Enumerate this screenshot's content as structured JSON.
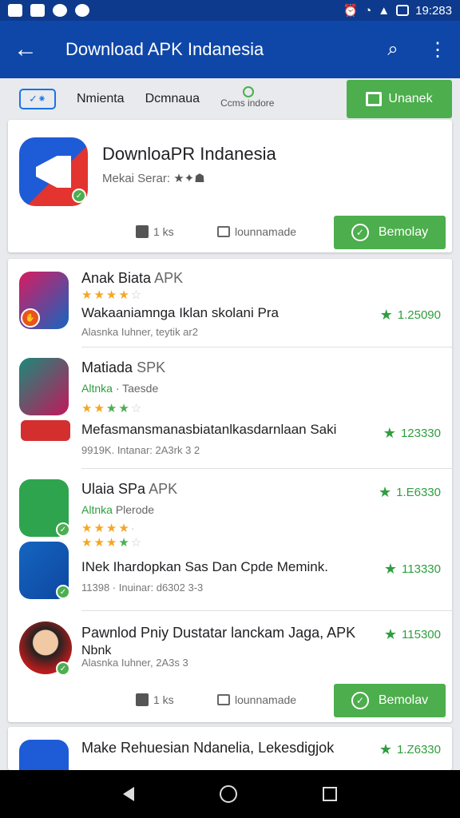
{
  "status": {
    "time": "19:283"
  },
  "appbar": {
    "title": "Download APK Indanesia"
  },
  "tabs": {
    "logo": "",
    "items": [
      "Nmienta",
      "Dcmnaua",
      "Ccms indore"
    ],
    "button_label": "Unanek"
  },
  "hero": {
    "title": "DownloaPR Indanesia",
    "sub": "Mekai Serar:",
    "likes": "1 ks",
    "comments": "lounnamade",
    "button": "Bemolay"
  },
  "apps": [
    {
      "name": "Anak Biata",
      "tag": "APK",
      "desc": "Wakaaniamnga Iklan skolani Pra",
      "foot": "Alasnka Iuhner, teytik ar2",
      "score": "1.25090"
    },
    {
      "name": "Matiada",
      "tag": "SPK",
      "meta_green": "Altnka",
      "meta_gray": "· Taesde",
      "desc": "Mefasmansmanasbiatanlkasdarnlaan Saki",
      "foot": "9919K. Intanar: 2A3rk 3 2",
      "score": "123330"
    },
    {
      "name": "Ulaia SPa",
      "tag": "APK",
      "meta_green": "Altnka",
      "meta_gray": "Plerode",
      "score": "1.E6330"
    },
    {
      "desc": "INek Ihardopkan Sas Dan Cpde Memink.",
      "foot": "11398 · Inuinar: d6302 3-3",
      "score": "113330"
    },
    {
      "name": "Pawnlod Pniy Dustatar lanckam Jaga, APK",
      "name2": "Nbnk",
      "foot": "Alasnka Iuhner, 2A3s 3",
      "score": "115300",
      "likes": "1 ks",
      "comments": "lounnamade",
      "button": "Bemolav"
    },
    {
      "name": "Make Rehuesian Ndanelia, Lekesdigjok",
      "score": "1.Z6330"
    }
  ]
}
